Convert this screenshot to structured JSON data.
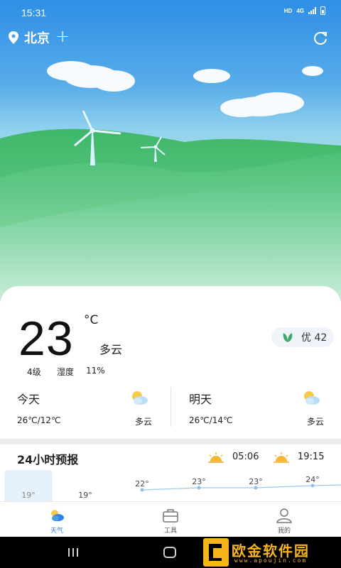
{
  "status_bar": {
    "time": "15:31",
    "network": "HD",
    "net_type": "4G"
  },
  "header": {
    "city": "北京",
    "add_symbol": "+"
  },
  "current": {
    "temperature": "23",
    "unit": "°C",
    "condition": "多云",
    "aqi_label": "优 42",
    "wind_level": "4级",
    "humidity_label": "湿度",
    "humidity_value": "11%"
  },
  "forecast_days": [
    {
      "name": "今天",
      "range": "26℃/12℃",
      "condition": "多云",
      "icon": "partly-cloudy-icon"
    },
    {
      "name": "明天",
      "range": "26℃/14℃",
      "condition": "多云",
      "icon": "partly-cloudy-icon"
    }
  ],
  "hourly": {
    "title": "24小时预报",
    "sunrise": "05:06",
    "sunset": "19:15",
    "temps": [
      "19°",
      "19°",
      "22°",
      "23°",
      "23°",
      "24°"
    ],
    "temp_values": [
      19,
      19,
      22,
      23,
      23,
      24
    ]
  },
  "tabs": [
    {
      "label": "天气",
      "icon": "weather-icon",
      "active": true
    },
    {
      "label": "工具",
      "icon": "toolbox-icon",
      "active": false
    },
    {
      "label": "我的",
      "icon": "profile-icon",
      "active": false
    }
  ],
  "watermark": {
    "text": "欧金软件园",
    "sub": "www.apoujin.com"
  },
  "colors": {
    "accent": "#2f86e0",
    "sky": "#4aa3ea",
    "hill": "#3db56a",
    "watermark": "#f6b51d"
  }
}
